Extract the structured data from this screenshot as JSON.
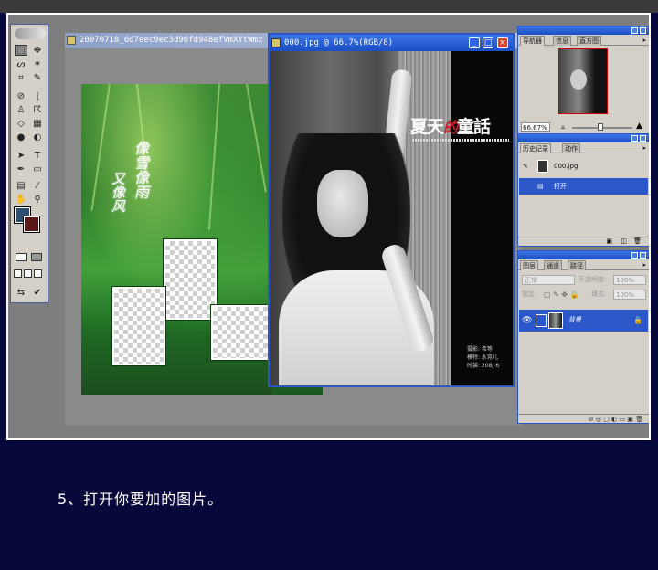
{
  "doc_background": {
    "title": "20070718_6d7eec9ec3d96fd948efVmXYtWmz"
  },
  "doc_front": {
    "title": "000.jpg @ 66.7%(RGB/8)",
    "photo_title_left": "夏天",
    "photo_title_mid": "的",
    "photo_title_right": "童話",
    "credits": [
      "摄影: 希等",
      "模特: 永晃儿",
      "时装: 208/ 6"
    ]
  },
  "green_canvas": {
    "calligraphy": [
      "像雪像雨",
      "又像风"
    ]
  },
  "navigator_panel": {
    "tabs": [
      "导航器",
      "信息",
      "直方图"
    ],
    "zoom": "66.67%"
  },
  "history_panel": {
    "tabs": [
      "历史记录",
      "动作"
    ],
    "items": [
      "000.jpg",
      "打开"
    ],
    "active_index": 1
  },
  "layers_panel": {
    "tabs": [
      "图层",
      "通道",
      "路径"
    ],
    "blend_mode": "正常",
    "opacity_label": "不透明度:",
    "opacity": "100%",
    "lock_label": "锁定:",
    "fill_label": "填充:",
    "fill": "100%",
    "layer_name": "背景"
  },
  "caption": "5、打开你要加的图片。",
  "colors": {
    "foreground": "#2f4f6f",
    "background": "#5a1818",
    "title_active": "#1c4ec4",
    "page_bg": "#08083a"
  }
}
